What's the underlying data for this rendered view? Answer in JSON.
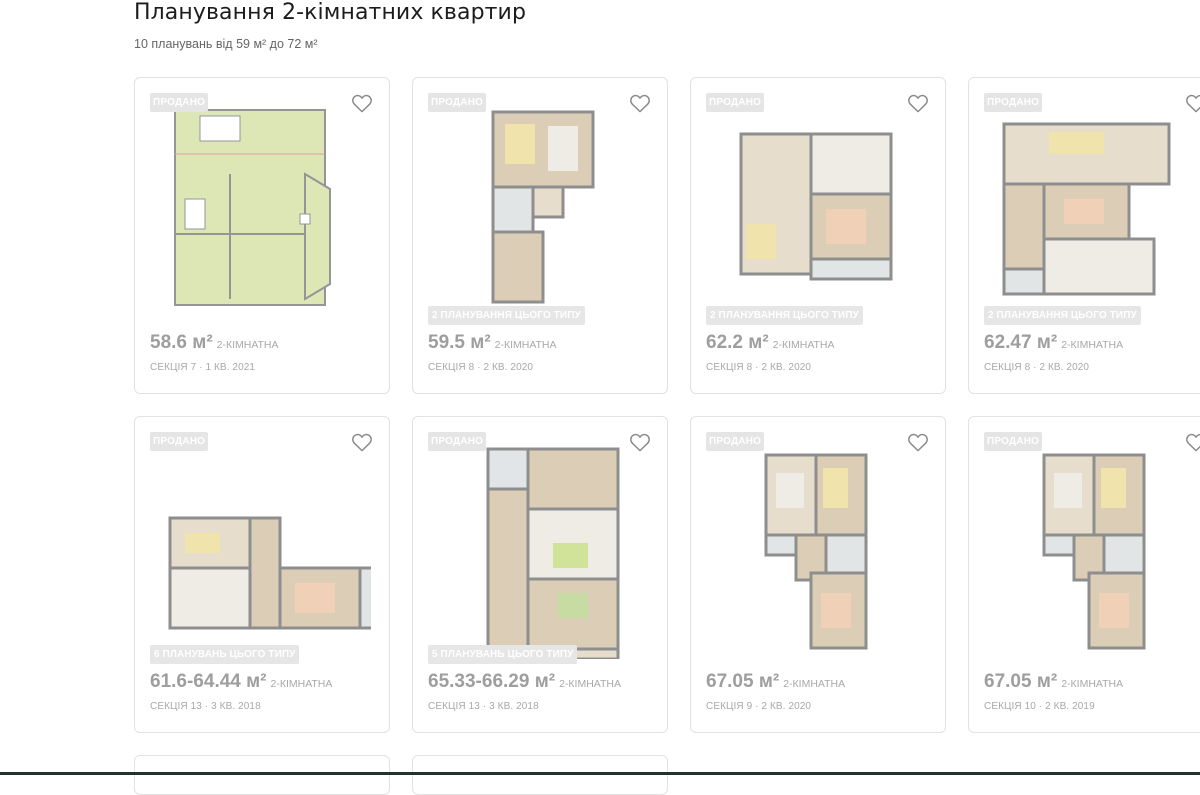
{
  "page": {
    "title": "Планування 2-кімнатних квартир",
    "subtitle": "10 планувань від 59 м² до 72 м²"
  },
  "labels": {
    "sold": "ПРОДАНО",
    "area_unit_sep": " "
  },
  "icons": {
    "favorite": "heart-outline-icon"
  },
  "colors": {
    "accent_plan": "#c9d98a",
    "muted_text": "#a8a8a8",
    "border": "#e2e2e2"
  },
  "cards": [
    {
      "sold": "ПРОДАНО",
      "area": "58.6 м²",
      "rooms": "2-КІМНАТНА",
      "meta": "СЕКЦІЯ 7 · 1 КВ. 2021",
      "plans_badge": "",
      "plan_style": "drawing"
    },
    {
      "sold": "ПРОДАНО",
      "area": "59.5 м²",
      "rooms": "2-КІМНАТНА",
      "meta": "СЕКЦІЯ 8 · 2 КВ. 2020",
      "plans_badge": "2 ПЛАНУВАННЯ ЦЬОГО ТИПУ",
      "plan_style": "tall"
    },
    {
      "sold": "ПРОДАНО",
      "area": "62.2 м²",
      "rooms": "2-КІМНАТНА",
      "meta": "СЕКЦІЯ 8 · 2 КВ. 2020",
      "plans_badge": "2 ПЛАНУВАННЯ ЦЬОГО ТИПУ",
      "plan_style": "block"
    },
    {
      "sold": "ПРОДАНО",
      "area": "62.47 м²",
      "rooms": "2-КІМНАТНА",
      "meta": "СЕКЦІЯ 8 · 2 КВ. 2020",
      "plans_badge": "2 ПЛАНУВАННЯ ЦЬОГО ТИПУ",
      "plan_style": "block2"
    },
    {
      "sold": "ПРОДАНО",
      "area": "61.6-64.44 м²",
      "rooms": "2-КІМНАТНА",
      "meta": "СЕКЦІЯ 13 · 3 КВ. 2018",
      "plans_badge": "6 ПЛАНУВАНЬ ЦЬОГО ТИПУ",
      "plan_style": "wide"
    },
    {
      "sold": "ПРОДАНО",
      "area": "65.33-66.29 м²",
      "rooms": "2-КІМНАТНА",
      "meta": "СЕКЦІЯ 13 · 3 КВ. 2018",
      "plans_badge": "5 ПЛАНУВАНЬ ЦЬОГО ТИПУ",
      "plan_style": "tower"
    },
    {
      "sold": "ПРОДАНО",
      "area": "67.05 м²",
      "rooms": "2-КІМНАТНА",
      "meta": "СЕКЦІЯ 9 · 2 КВ. 2020",
      "plans_badge": "",
      "plan_style": "tall2"
    },
    {
      "sold": "ПРОДАНО",
      "area": "67.05 м²",
      "rooms": "2-КІМНАТНА",
      "meta": "СЕКЦІЯ 10 · 2 КВ. 2019",
      "plans_badge": "",
      "plan_style": "tall2"
    }
  ]
}
